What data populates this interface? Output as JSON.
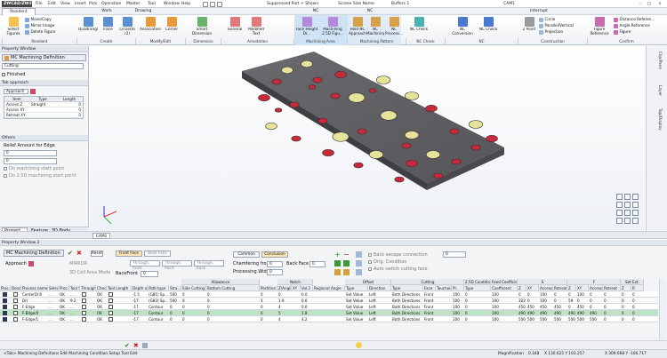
{
  "app": {
    "logo": "ZWCAD/ZW3D",
    "window_title": "CAM1",
    "document_title": "Suppressed Part + Shown",
    "view_mode": "Screen Size Name",
    "buffer": "Buffers 1"
  },
  "menu": [
    "File",
    "Edit",
    "View",
    "Insert",
    "Pick",
    "Operation",
    "Master",
    "Tool",
    "Window",
    "Help"
  ],
  "ribbon_tabs": [
    "Resident",
    "Work",
    "Drawing",
    "NC",
    "NC",
    "Interrupt"
  ],
  "ribbon": {
    "resident_buttons": [
      {
        "label": "Select Figures"
      }
    ],
    "resident_small": [
      "Move/Copy",
      "Mirror Image",
      "Delete Figure"
    ],
    "create_buttons": [
      {
        "label": "Quadrangle"
      },
      {
        "label": "Trace"
      },
      {
        "label": "Circle(to r2)"
      }
    ],
    "modify_buttons": [
      {
        "label": "Associative"
      },
      {
        "label": "Corner"
      }
    ],
    "dimension_buttons": [
      {
        "label": "Smart Dimension"
      }
    ],
    "annotation_buttons": [
      {
        "label": "General"
      },
      {
        "label": "Modified Text"
      }
    ],
    "machining_area_buttons": [
      {
        "label": "Face Height Di..."
      },
      {
        "label": "Machining 2.5D Figu..."
      }
    ],
    "machining_pattern_buttons": [
      {
        "label": "Hold NC Approach"
      },
      {
        "label": "NC Machining..."
      },
      {
        "label": "NC Process..."
      }
    ],
    "nc_check_buttons": [
      {
        "label": "NC Check"
      }
    ],
    "nc_buttons": [
      {
        "label": "NC Conversion"
      },
      {
        "label": "NC Check"
      }
    ],
    "construction_small": [
      "Circle",
      "Parallel/Vertical",
      "Projection"
    ],
    "construction_btn": "2 Point",
    "confirm_buttons": [
      {
        "label": "Figure Reference"
      }
    ],
    "confirm_small": [
      "Distance Referen...",
      "Angle Reference",
      "Figure"
    ],
    "groups": [
      "Resident",
      "Create",
      "Modify/Edit",
      "Dimension",
      "Annotation",
      "Machining Area",
      "Machining Pattern",
      "NC Check",
      "NC",
      "Construction",
      "Confirm"
    ]
  },
  "left_panel": {
    "header": "Property Window",
    "definition": "MC Machining Definition",
    "process_select": "Cutting",
    "finished_label": "Finished",
    "tab_approach_header": "Tab approach",
    "approach_label": "Approach",
    "table_headers": [
      "Item",
      "Type",
      "Length"
    ],
    "table_rows": [
      {
        "item": "Access Z",
        "type": "Straight",
        "length": "0"
      },
      {
        "item": "Access XY",
        "type": "",
        "length": "0"
      },
      {
        "item": "Retreat XY",
        "type": "",
        "length": "0"
      }
    ],
    "others_header": "Others",
    "relief_label": "Relief Amount for Edge",
    "relief_value": "0",
    "relief_select": "0",
    "opt1": "Do machining start point",
    "opt2": "Do 2.5D machining start point",
    "tabs": [
      "Propert...",
      "Feature",
      "3D Body"
    ]
  },
  "viewport": {
    "right_strip": [
      "Clip/Pane",
      "Layer",
      "Top/Display"
    ],
    "doc_tab": "CAM1"
  },
  "property_window2": {
    "header": "Property Window 2",
    "definition": "MC Machining Definition",
    "reset_btn": "Reset",
    "approach_label": "Approach",
    "front_face": "Front Face",
    "back_face": "Back Face",
    "through_front": "Through, front",
    "through_back": "Through, back",
    "front_point": "Through, Point",
    "back_point": "Through, back",
    "backfront_label": "BaceFront",
    "backfront_value": "0",
    "common_label": "Common",
    "conclusion_label": "Conclusion",
    "chamfering_front_label": "Chamfering front",
    "chamfering_front_value": "0",
    "back_face_label": "Back Face",
    "back_face_value": "0",
    "processing_width_label": "Processing Width",
    "processing_width_value": "0",
    "back_escape": "Back escape connection",
    "orig_condition": "Orig. Condition",
    "auto_switch": "Auto switch cutting face",
    "mirror_label": "MIRROR",
    "third_label": "3D Cell Area Mode",
    "value_box": "0"
  },
  "table": {
    "group_headers": [
      "Allowance",
      "Notch",
      "Offset",
      "Cutting",
      "2.5D Condition",
      "Feed Coefficient",
      "S",
      "F",
      "Set Ext."
    ],
    "headers": [
      "Proc...",
      "Devo...",
      "Process name",
      "Select",
      "Proc...",
      "Tool Sel.",
      "Through",
      "Check",
      "Tool Length",
      "Depth of Cut",
      "Path type",
      "Stra...",
      "Side Cutting",
      "Bottom Cutting",
      "Partition",
      "Z/Angle",
      "XY",
      "Vol.2",
      "Regional Angle",
      "Type",
      "Direction",
      "Type",
      "Face",
      "Touchoid",
      "Pl..",
      "Type",
      "Coefficient",
      "Z",
      "XY",
      "Access",
      "Retreat",
      "Z",
      "XY",
      "Access",
      "Retreat",
      "Z",
      "R"
    ],
    "rows": [
      {
        "name": "CenterDrill",
        "select": "...",
        "proc": "OK",
        "tool": "...",
        "check": "OK",
        "depth": "-1.5",
        "path": "(G81) Sp...",
        "stra": "500",
        "side": "0",
        "bottom": "0",
        "partition": "0",
        "zang": "0",
        "xy": "",
        "vol": "0.0",
        "off_type": "Set Value",
        "dir": "Left",
        "cut_type": "Both Directions",
        "face": "Front",
        "pl": "100",
        "cond_type": "0",
        "coef": "100",
        "sz": "0",
        "sxy": "0",
        "sacc": "100",
        "sret": "0",
        "fz": "0",
        "fxy": "100",
        "facc": "0",
        "fret": "0",
        "ez": "0",
        "er": "0",
        "hl": false
      },
      {
        "name": "Drl",
        "select": "...",
        "proc": "OK",
        "tool": "9.2",
        "check": "OK",
        "depth": "-17",
        "path": "(G83) Sp...",
        "stra": "500",
        "side": "0",
        "bottom": "0",
        "partition": "1",
        "zang": "1.9",
        "xy": "",
        "vol": "0.0",
        "off_type": "Set Value",
        "dir": "Left",
        "cut_type": "Both Directions",
        "face": "Front",
        "pl": "100",
        "cond_type": "0",
        "coef": "100",
        "sz": "322",
        "sxy": "0",
        "sacc": "100",
        "sret": "0",
        "fz": "59",
        "fxy": "0",
        "facc": "0",
        "fret": "0",
        "ez": "0",
        "er": "0",
        "hl": false
      },
      {
        "name": "F-Edge",
        "select": "...",
        "proc": "OK",
        "tool": "...",
        "check": "OK",
        "depth": "-17",
        "path": "Contour",
        "stra": "0",
        "side": "0",
        "bottom": "0",
        "partition": "0",
        "zang": "4",
        "xy": "",
        "vol": "0.0",
        "off_type": "Set Value",
        "dir": "Left",
        "cut_type": "Both Directions",
        "face": "Front",
        "pl": "100",
        "cond_type": "0",
        "coef": "100",
        "sz": "450",
        "sxy": "450",
        "sacc": "450",
        "sret": "450",
        "fz": "0",
        "fxy": "450",
        "facc": "0",
        "fret": "0",
        "ez": "0",
        "er": "0",
        "hl": false
      },
      {
        "name": "F-Bdge/0",
        "select": "...",
        "proc": "OK",
        "tool": "...",
        "check": "OK",
        "depth": "-17",
        "path": "Contour",
        "stra": "0",
        "side": "0",
        "bottom": "0",
        "partition": "0",
        "zang": "5",
        "xy": "",
        "vol": "1.8",
        "off_type": "Set Value",
        "dir": "Left",
        "cut_type": "Both Directions",
        "face": "Front",
        "pl": "100",
        "cond_type": "0",
        "coef": "100",
        "sz": "490",
        "sxy": "490",
        "sacc": "490",
        "sret": "490",
        "fz": "490",
        "fxy": "490",
        "facc": "490",
        "fret": "0",
        "ez": "0",
        "er": "0",
        "hl": true
      },
      {
        "name": "F-Edge/1",
        "select": "...",
        "proc": "OK",
        "tool": "...",
        "check": "OK",
        "depth": "-17",
        "path": "Contour",
        "stra": "0",
        "side": "0",
        "bottom": "0",
        "partition": "0",
        "zang": "4",
        "xy": "",
        "vol": "4.2",
        "off_type": "Set Value",
        "dir": "Left",
        "cut_type": "Both Directions",
        "face": "Front",
        "pl": "100",
        "cond_type": "0",
        "coef": "100",
        "sz": "500",
        "sxy": "500",
        "sacc": "500",
        "sret": "500",
        "fz": "500",
        "fxy": "500",
        "facc": "500",
        "fret": "0",
        "ez": "0",
        "er": "0",
        "hl": false
      }
    ]
  },
  "status": {
    "left": "<Tab> Machining Definitions Edit Machining Condition Setup Tool Edit",
    "magnification_label": "Magnification",
    "magnification": "0.348",
    "coord1": "X 130.625 Y 103.257",
    "coord2": "X 309.668 Y -106.717"
  },
  "colors": {
    "plate": "#5d5d60",
    "plate_edge": "#46464a",
    "hole_yellow": "#e6e39a",
    "hole_red": "#c82a3a",
    "ribbon_highlight": "#cfe3f5"
  }
}
